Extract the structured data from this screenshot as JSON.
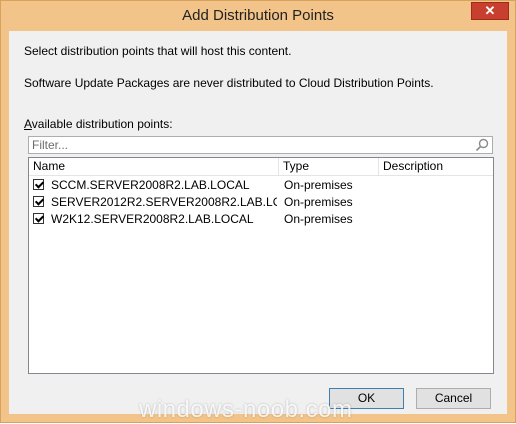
{
  "window": {
    "title": "Add Distribution Points",
    "close_glyph": "✕"
  },
  "instructions": {
    "line1": "Select distribution points that will host this content.",
    "line2": "Software Update Packages are never distributed to Cloud Distribution Points."
  },
  "available": {
    "label_access_key": "A",
    "label_rest": "vailable distribution points:",
    "filter_placeholder": "Filter..."
  },
  "table": {
    "columns": [
      "Name",
      "Type",
      "Description"
    ],
    "rows": [
      {
        "checked": true,
        "name": "SCCM.SERVER2008R2.LAB.LOCAL",
        "type": "On-premises",
        "description": ""
      },
      {
        "checked": true,
        "name": "SERVER2012R2.SERVER2008R2.LAB.LOC...",
        "type": "On-premises",
        "description": ""
      },
      {
        "checked": true,
        "name": "W2K12.SERVER2008R2.LAB.LOCAL",
        "type": "On-premises",
        "description": ""
      }
    ]
  },
  "buttons": {
    "ok": "OK",
    "cancel": "Cancel"
  },
  "watermark": "windows-noob.com",
  "colors": {
    "frame": "#f2c48a",
    "close": "#c7402f",
    "client": "#f0f0f0"
  },
  "icons": {
    "filter": "search-icon",
    "close": "close-icon"
  }
}
